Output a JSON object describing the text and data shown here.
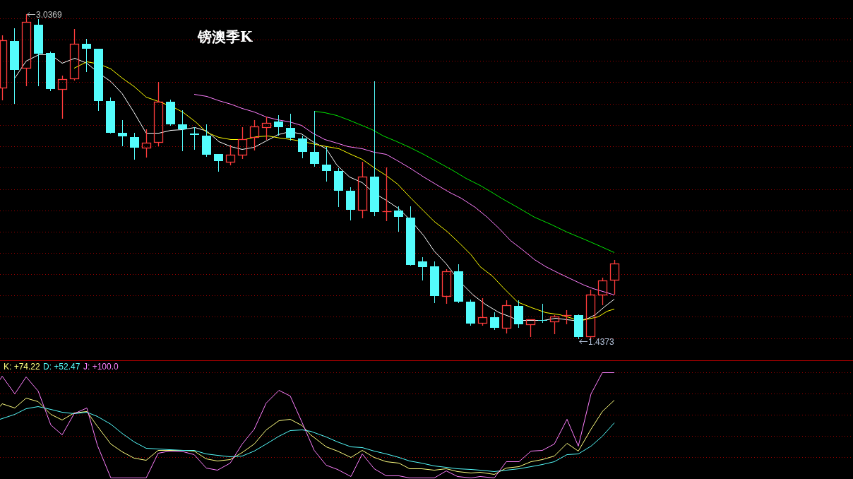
{
  "chart": {
    "title": "镑澳季K",
    "high_label": "3.0369",
    "low_label": "1.4373"
  },
  "indicator": {
    "readouts": [
      {
        "label": "K: +74.22",
        "color": "#ffff80"
      },
      {
        "label": "D: +52.47",
        "color": "#54fcfc"
      },
      {
        "label": "J: +100.0",
        "color": "#ff80ff"
      }
    ]
  }
}
